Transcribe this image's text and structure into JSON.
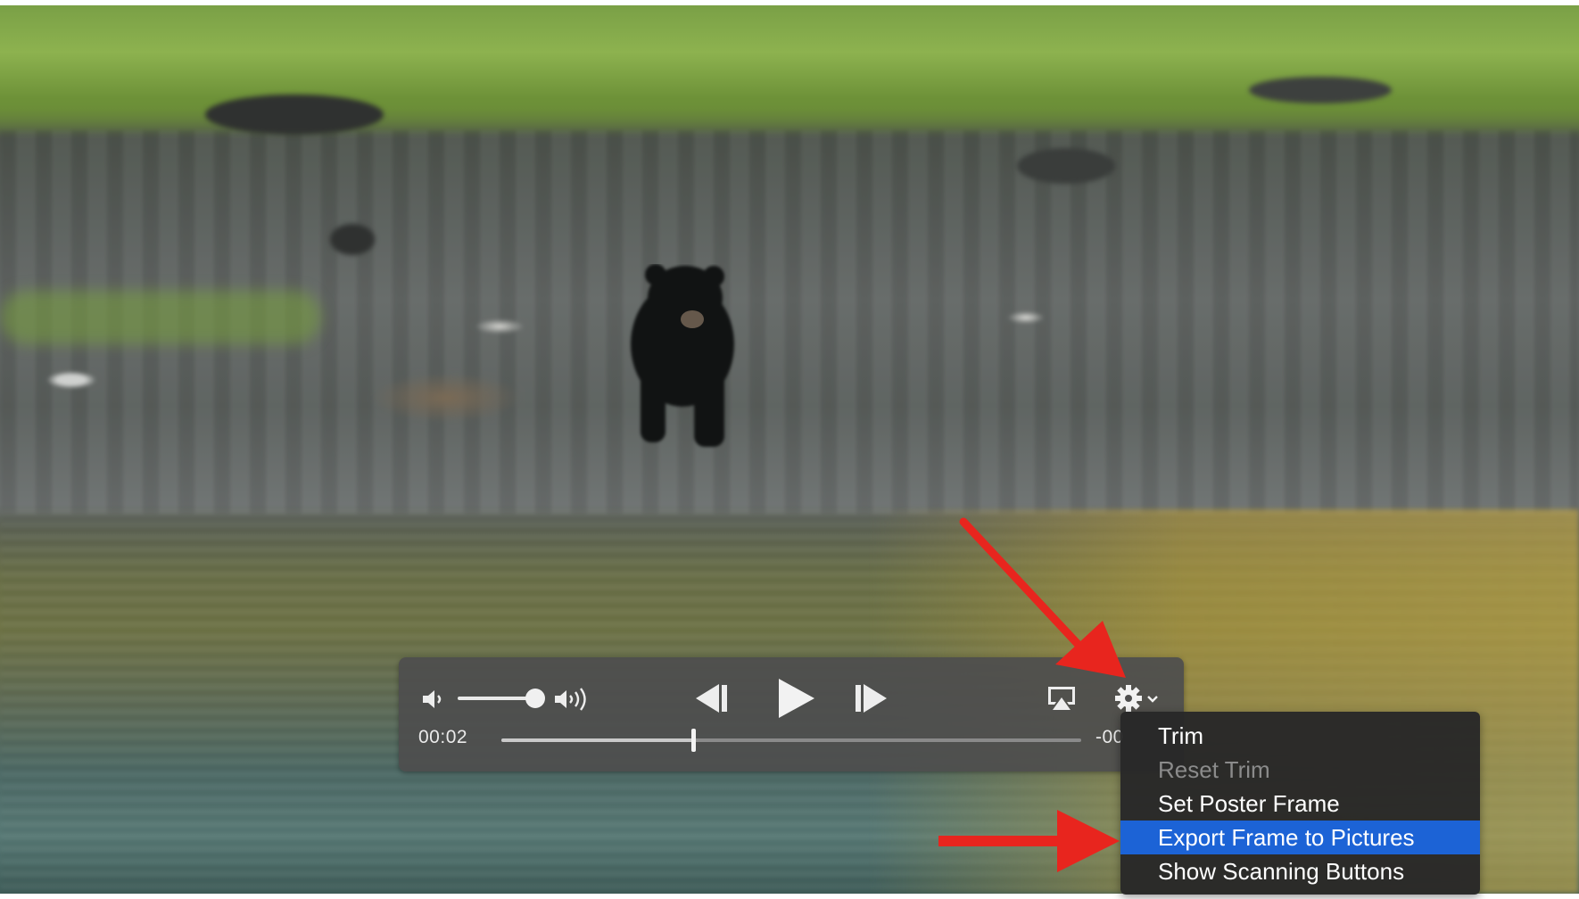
{
  "player": {
    "elapsed_time": "00:02",
    "remaining_time": "-00",
    "volume_level": 0.85,
    "playback_progress": 0.33,
    "icons": {
      "volume_low": "speaker-low-icon",
      "volume_high": "speaker-high-icon",
      "skip_back": "skip-back-icon",
      "play": "play-icon",
      "skip_forward": "skip-forward-icon",
      "airplay": "airplay-icon",
      "settings": "gear-icon"
    }
  },
  "menu": {
    "items": [
      {
        "label": "Trim",
        "enabled": true,
        "selected": false
      },
      {
        "label": "Reset Trim",
        "enabled": false,
        "selected": false
      },
      {
        "label": "Set Poster Frame",
        "enabled": true,
        "selected": false
      },
      {
        "label": "Export Frame to Pictures",
        "enabled": true,
        "selected": true
      },
      {
        "label": "Show Scanning Buttons",
        "enabled": true,
        "selected": false
      }
    ]
  },
  "colors": {
    "hud_background": "#4e4e4e",
    "menu_background": "#282828",
    "menu_selection": "#1c63d6",
    "annotation_arrow": "#e8251e"
  }
}
